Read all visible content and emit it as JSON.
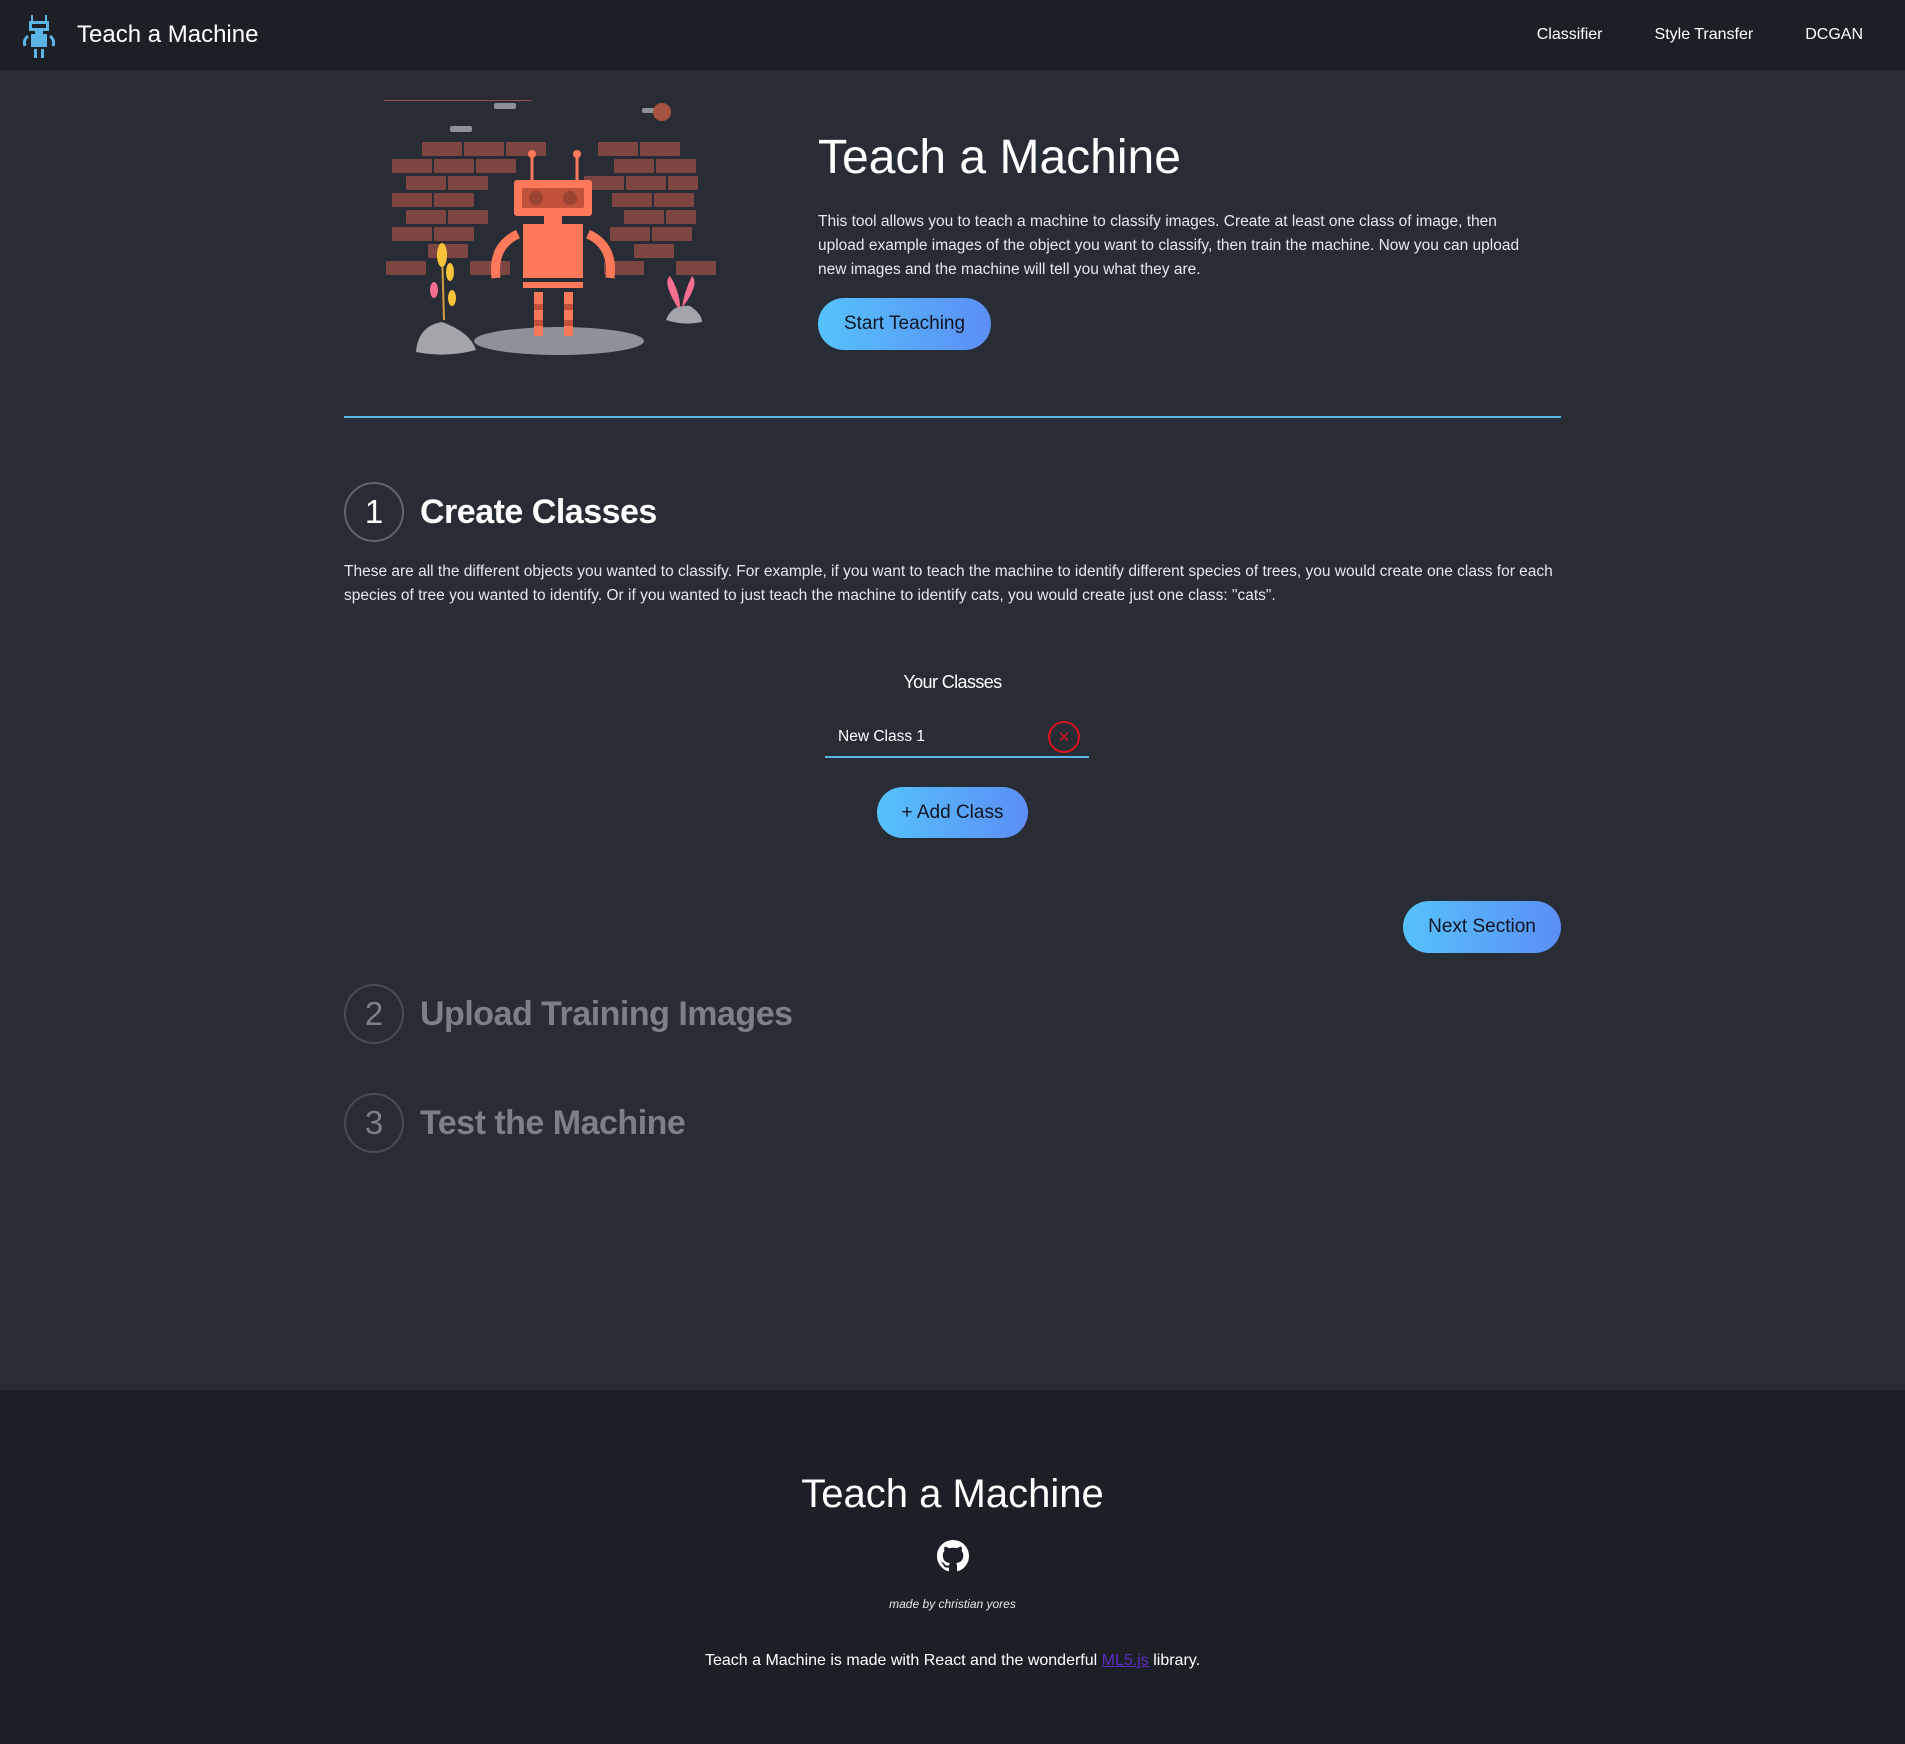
{
  "navbar": {
    "title": "Teach a Machine",
    "links": [
      "Classifier",
      "Style Transfer",
      "DCGAN"
    ]
  },
  "hero": {
    "title": "Teach a Machine",
    "description": "This tool allows you to teach a machine to classify images. Create at least one class of image, then upload example images of the object you want to classify, then train the machine. Now you can upload new images and the machine will tell you what they are.",
    "start_button": "Start Teaching"
  },
  "steps": [
    {
      "number": "1",
      "title": "Create Classes"
    },
    {
      "number": "2",
      "title": "Upload Training Images"
    },
    {
      "number": "3",
      "title": "Test the Machine"
    }
  ],
  "create_classes": {
    "description": "These are all the different objects you wanted to classify. For example, if you want to teach the machine to identify different species of trees, you would create one class for each species of tree you wanted to identify. Or if you wanted to just teach the machine to identify cats, you would create just one class: \"cats\".",
    "classes_label": "Your Classes",
    "classes": [
      {
        "value": "New Class 1"
      }
    ],
    "remove_icon": "close-icon",
    "add_button": "+ Add Class",
    "next_button": "Next Section"
  },
  "footer": {
    "title": "Teach a Machine",
    "github_icon": "github-icon",
    "made_by": "made by christian yores",
    "note_before": "Teach a Machine is made with React and the wonderful ",
    "link_text": "ML5.js",
    "note_after": " library."
  },
  "colors": {
    "background": "#282c35",
    "navbar_bg": "#1c1f25",
    "accent": "#5ab4e6",
    "button_gradient_start": "#55c2fb",
    "button_gradient_end": "#5b8ef5",
    "remove": "#d4151f",
    "robot": "#fe785a",
    "brick": "#7e4643"
  }
}
